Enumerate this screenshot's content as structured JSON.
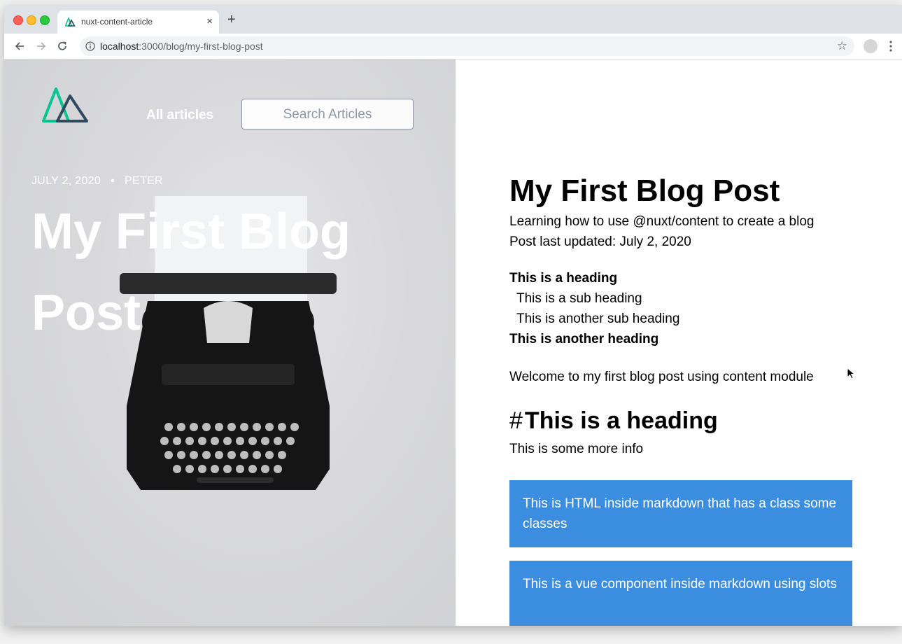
{
  "browser": {
    "tab_title": "nuxt-content-article",
    "tab_close": "×",
    "new_tab": "+",
    "url_host": "localhost",
    "url_path": ":3000/blog/my-first-blog-post",
    "star": "☆"
  },
  "hero": {
    "nav_all_articles": "All articles",
    "search_placeholder": "Search Articles",
    "date": "JULY 2, 2020",
    "separator": "•",
    "author": "PETER",
    "title": "My First Blog Post"
  },
  "article": {
    "title": "My First Blog Post",
    "description": "Learning how to use @nuxt/content to create a blog",
    "updated": "Post last updated: July 2, 2020",
    "toc": [
      {
        "level": "h2",
        "text": "This is a heading"
      },
      {
        "level": "h3",
        "text": "This is a sub heading"
      },
      {
        "level": "h3",
        "text": "This is another sub heading"
      },
      {
        "level": "h2",
        "text": "This is another heading"
      }
    ],
    "welcome": "Welcome to my first blog post using content module",
    "heading_hash": "#",
    "heading": "This is a heading",
    "more_info": "This is some more info",
    "html_callout": "This is HTML inside markdown that has a class some classes",
    "vue_callout": "This is a vue component inside markdown using slots"
  },
  "colors": {
    "callout_bg": "#3a8ddf",
    "logo_green": "#00c58e",
    "logo_dark": "#2f495e"
  },
  "icons": [
    "back-arrow-icon",
    "forward-arrow-icon",
    "reload-icon",
    "info-icon",
    "star-icon",
    "extension-icon",
    "menu-dots-icon",
    "nuxt-logo-icon",
    "typewriter-image",
    "mouse-cursor-icon"
  ]
}
